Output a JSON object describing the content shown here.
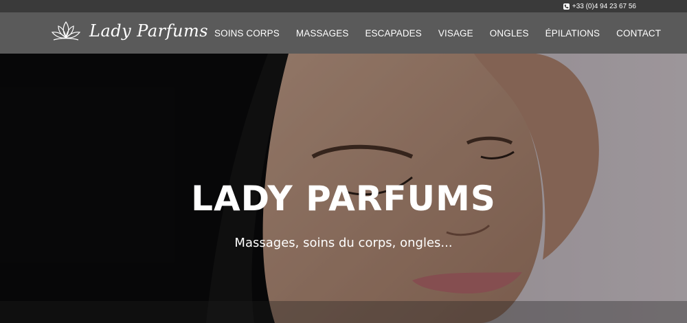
{
  "topbar": {
    "phone_icon": "phone-icon",
    "phone": "+33 (0)4 94 23 67 56"
  },
  "header": {
    "logo_icon": "lotus-icon",
    "logo_text": "Lady Parfums",
    "nav": [
      {
        "label": "SOINS CORPS"
      },
      {
        "label": "MASSAGES"
      },
      {
        "label": "ESCAPADES"
      },
      {
        "label": "VISAGE"
      },
      {
        "label": "ONGLES"
      },
      {
        "label": "ÉPILATIONS"
      },
      {
        "label": "CONTACT"
      }
    ]
  },
  "hero": {
    "title": "LADY PARFUMS",
    "subtitle": "Massages, soins du corps, ongles..."
  },
  "colors": {
    "topbar_bg": "#3a3a3a",
    "navbar_bg": "#5a5a5a",
    "text": "#ffffff"
  }
}
